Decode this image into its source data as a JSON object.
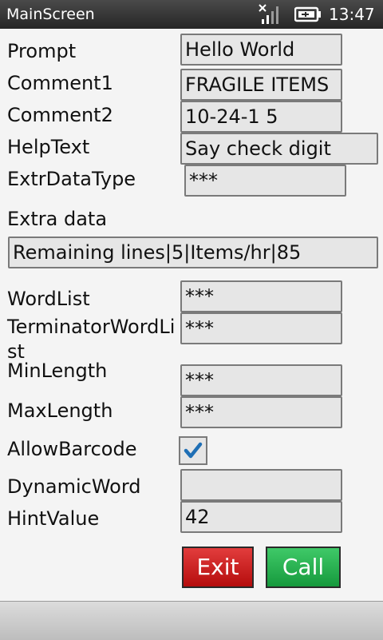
{
  "statusbar": {
    "title": "MainScreen",
    "time": "13:47",
    "signal_icon": "signal-strength-icon",
    "battery_icon": "battery-charging-icon"
  },
  "form": {
    "prompt": {
      "label": "Prompt",
      "value": "Hello World"
    },
    "comment1": {
      "label": "Comment1",
      "value": "FRAGILE ITEMS"
    },
    "comment2": {
      "label": "Comment2",
      "value": "10-24-1 5"
    },
    "helptext": {
      "label": "HelpText",
      "value": "Say check digit"
    },
    "extrdatatype": {
      "label": "ExtrDataType",
      "value": "***"
    },
    "extradata": {
      "label": "Extra data",
      "value": "Remaining lines|5|Items/hr|85"
    },
    "wordlist": {
      "label": "WordList",
      "value": "***"
    },
    "terminatorwordlist": {
      "label": "TerminatorWordList",
      "value": "***"
    },
    "minlength": {
      "label": "MinLength",
      "value": "***"
    },
    "maxlength": {
      "label": "MaxLength",
      "value": "***"
    },
    "allowbarcode": {
      "label": "AllowBarcode",
      "checked": true
    },
    "dynamicword": {
      "label": "DynamicWord",
      "value": ""
    },
    "hintvalue": {
      "label": "HintValue",
      "value": "42"
    }
  },
  "buttons": {
    "exit": "Exit",
    "call": "Call"
  },
  "colors": {
    "exit_button": "#c91818",
    "call_button": "#22ad4a",
    "check_mark": "#1f6fb5"
  }
}
